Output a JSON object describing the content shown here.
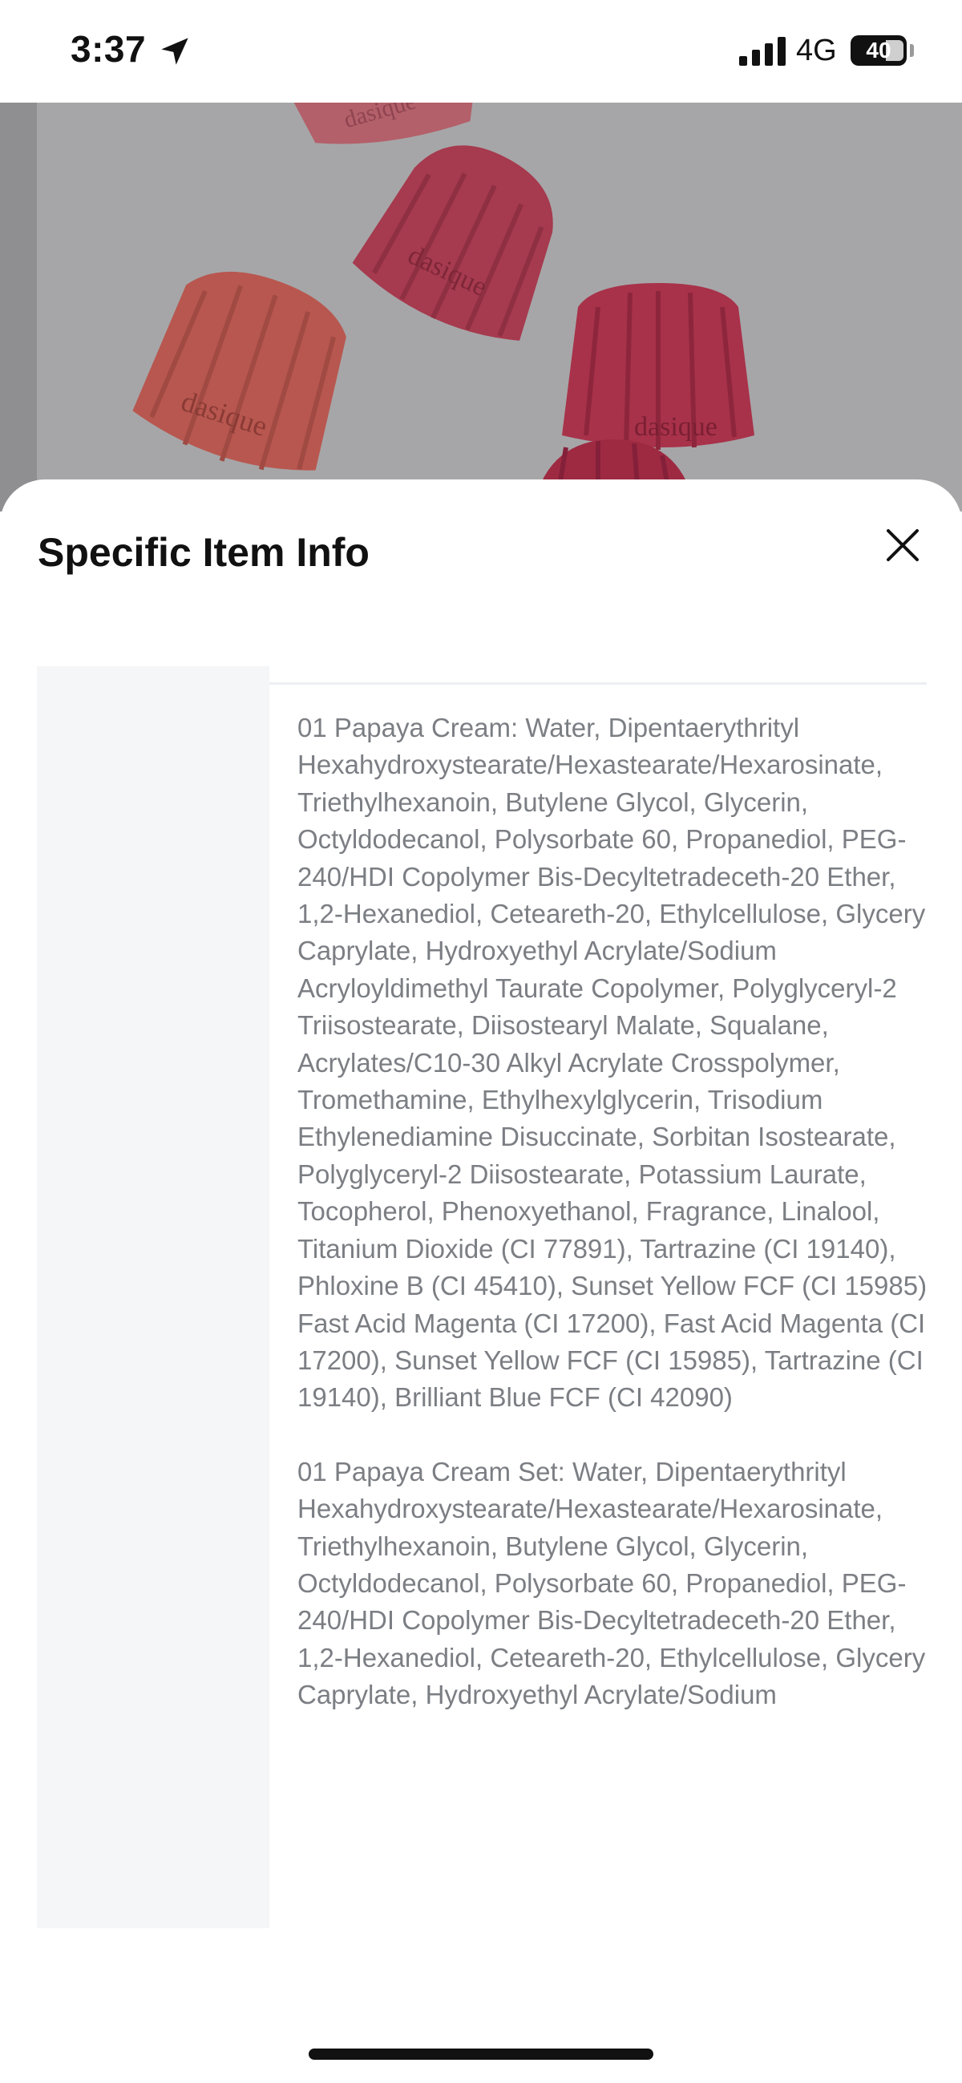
{
  "status_bar": {
    "time": "3:37",
    "network": "4G",
    "battery": "40"
  },
  "sheet": {
    "title": "Specific Item Info",
    "close_icon": "close-icon",
    "ingredients": [
      "01 Papaya Cream: Water, Dipentaerythrityl Hexahydroxystearate/Hexastearate/Hexarosinate, Triethylhexanoin, Butylene Glycol, Glycerin, Octyldodecanol, Polysorbate 60, Propanediol, PEG-240/HDI Copolymer Bis-Decyltetradeceth-20 Ether, 1,2-Hexanediol, Ceteareth-20, Ethylcellulose, Glyceryl Caprylate, Hydroxyethyl Acrylate/Sodium Acryloyldimethyl Taurate Copolymer, Polyglyceryl-2 Triisostearate, Diisostearyl Malate, Squalane, Acrylates/C10-30 Alkyl Acrylate Crosspolymer, Tromethamine, Ethylhexylglycerin, Trisodium Ethylenediamine Disuccinate, Sorbitan Isostearate, Polyglyceryl-2 Diisostearate, Potassium Laurate, Tocopherol, Phenoxyethanol, Fragrance, Linalool, Titanium Dioxide (CI 77891), Tartrazine (CI 19140), Phloxine B (CI 45410), Sunset Yellow FCF (CI 15985), Fast Acid Magenta (CI 17200), Fast Acid Magenta (CI 17200), Sunset Yellow FCF (CI 15985), Tartrazine (CI 19140), Brilliant Blue FCF (CI 42090)",
      "01 Papaya Cream Set: Water, Dipentaerythrityl Hexahydroxystearate/Hexastearate/Hexarosinate, Triethylhexanoin, Butylene Glycol, Glycerin, Octyldodecanol, Polysorbate 60, Propanediol, PEG-240/HDI Copolymer Bis-Decyltetradeceth-20 Ether, 1,2-Hexanediol, Ceteareth-20, Ethylcellulose, Glyceryl Caprylate, Hydroxyethyl Acrylate/Sodium"
    ]
  },
  "hero": {
    "brand_text": "dasique",
    "colors": {
      "overlay": "#8f8f91",
      "jelly_dark": "#a63a4e",
      "jelly_light": "#b8574f"
    }
  }
}
